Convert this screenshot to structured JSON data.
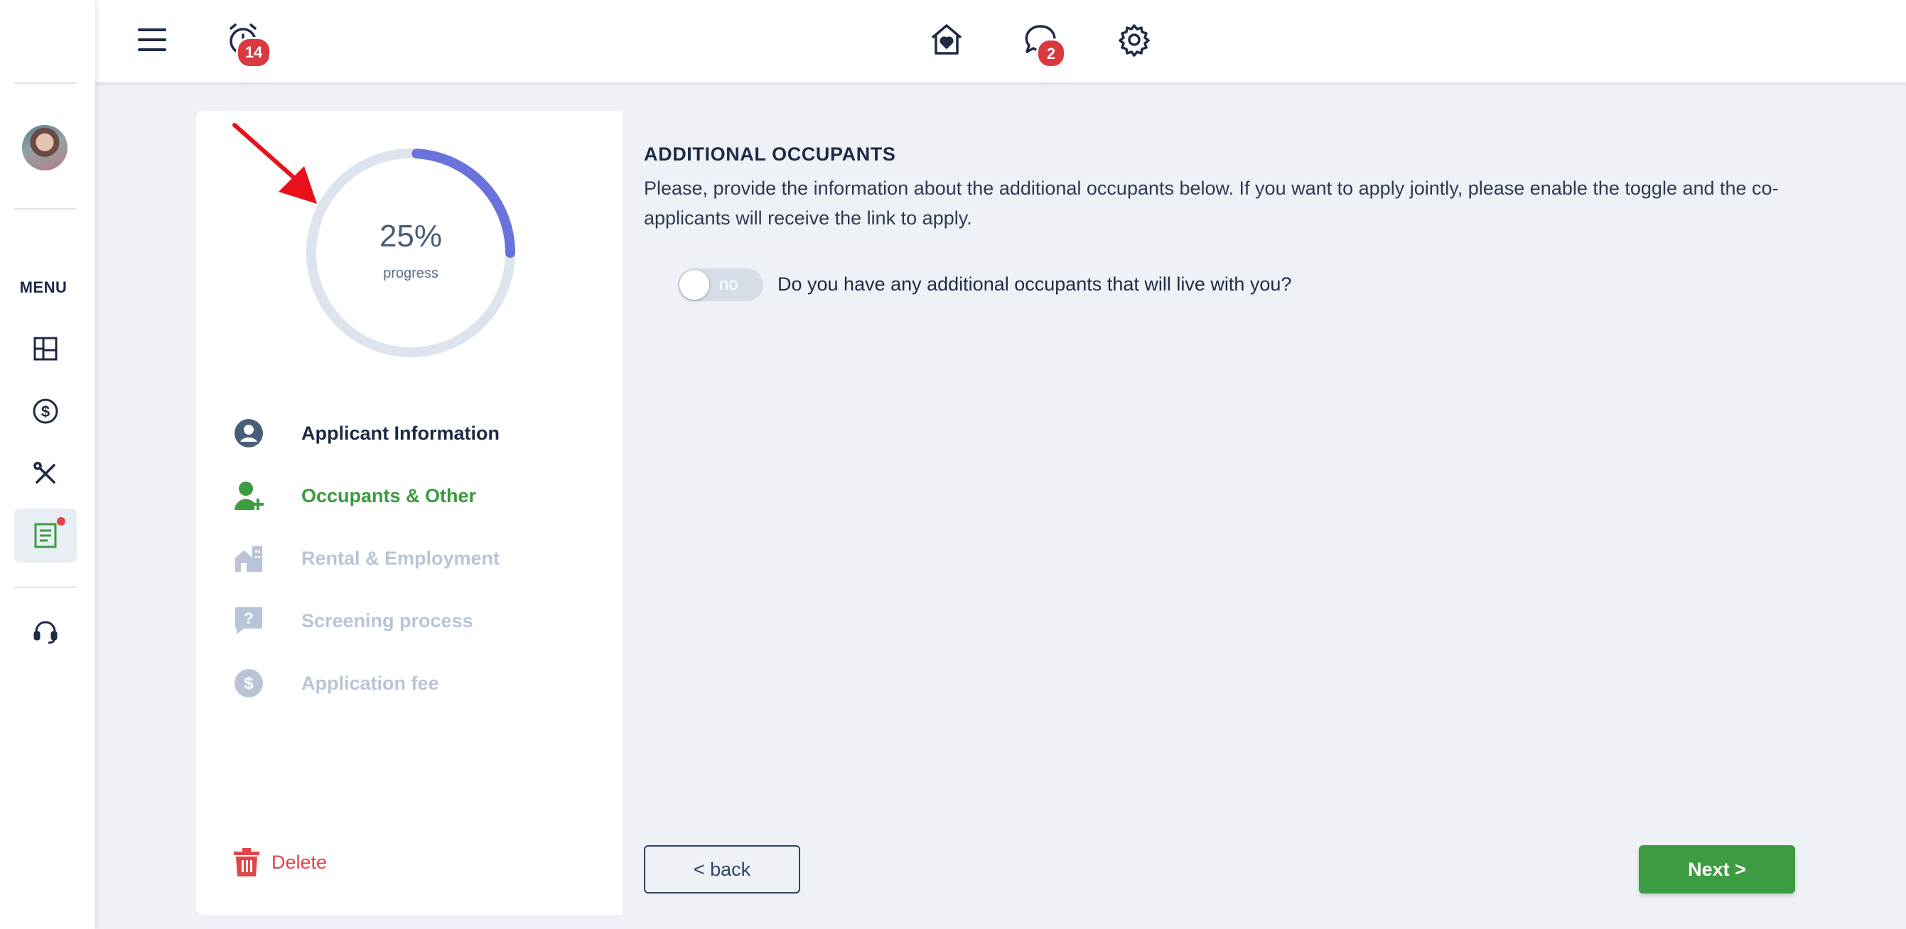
{
  "topbar": {
    "alarm_badge": "14",
    "messages_badge": "2"
  },
  "sidebar": {
    "menu_label": "MENU",
    "items": [
      {
        "icon": "dashboard-icon"
      },
      {
        "icon": "dollar-icon"
      },
      {
        "icon": "tools-icon"
      },
      {
        "icon": "application-icon",
        "active": true,
        "notification": true
      },
      {
        "icon": "support-headset-icon"
      }
    ]
  },
  "progress": {
    "value_text": "25%",
    "label": "progress",
    "fraction": 0.25,
    "track_color": "#dde4ee",
    "fill_color": "#6a72dc"
  },
  "steps": [
    {
      "label": "Applicant Information",
      "state": "done",
      "icon": "user-circle-icon"
    },
    {
      "label": "Occupants & Other",
      "state": "current",
      "icon": "add-user-icon"
    },
    {
      "label": "Rental & Employment",
      "state": "todo",
      "icon": "building-icon"
    },
    {
      "label": "Screening process",
      "state": "todo",
      "icon": "question-bubble-icon"
    },
    {
      "label": "Application fee",
      "state": "todo",
      "icon": "dollar-circle-icon"
    }
  ],
  "delete_label": "Delete",
  "main": {
    "title": "ADDITIONAL OCCUPANTS",
    "description": "Please, provide the information about the additional occupants below. If you want to apply jointly, please enable the toggle and the co-applicants will receive the link to apply.",
    "toggle_text": "no",
    "toggle_question": "Do you have any additional occupants that will live with you?",
    "back_label": "< back",
    "next_label": "Next >"
  },
  "colors": {
    "accent_green": "#3d9c41",
    "danger_red": "#e0454a",
    "navy": "#1e2a44"
  }
}
